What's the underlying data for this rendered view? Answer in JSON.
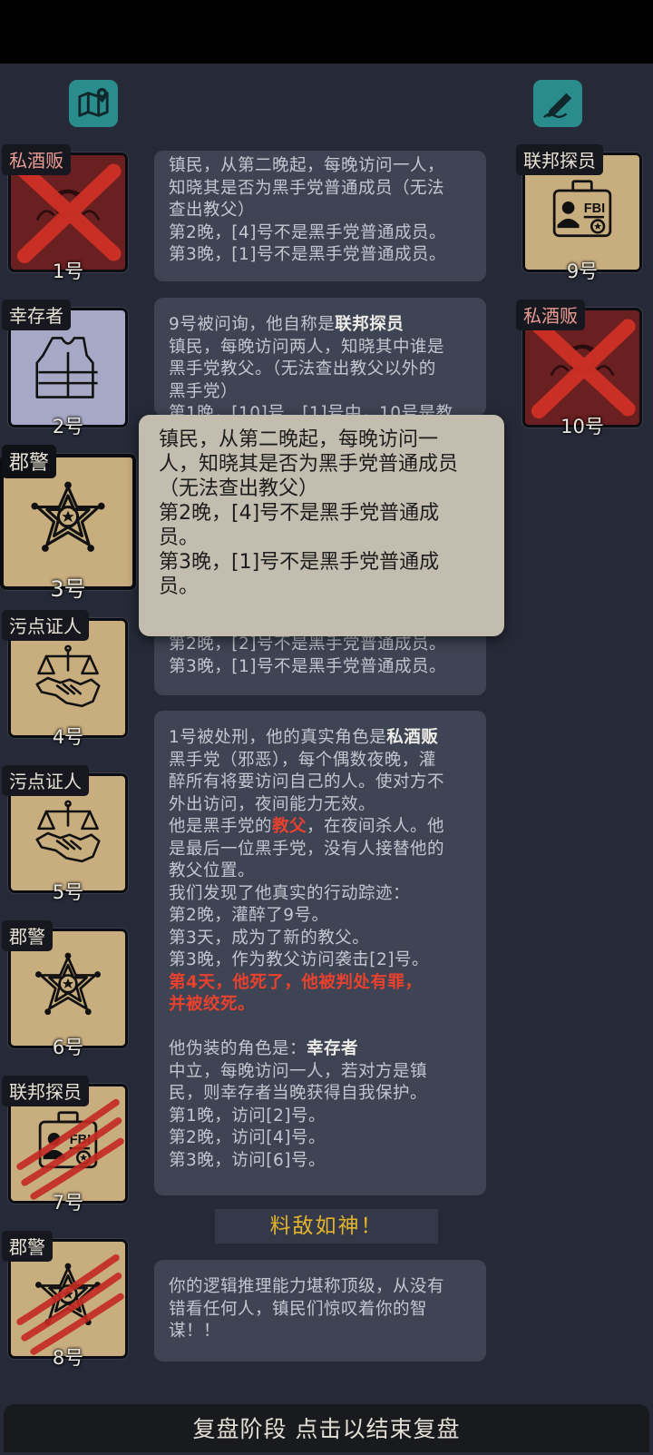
{
  "top_icons": {
    "map": "map-pin-icon",
    "notes": "pen-edit-icon"
  },
  "players": [
    {
      "tag": "私酒贩",
      "number": "1号",
      "icon": "bootlegger-icon",
      "state": "executed"
    },
    {
      "tag": "幸存者",
      "number": "2号",
      "icon": "vest-icon",
      "state": "alive"
    },
    {
      "tag": "郡警",
      "number": "3号",
      "icon": "sheriff-badge-icon",
      "state": "selected"
    },
    {
      "tag": "污点证人",
      "number": "4号",
      "icon": "scales-handshake-icon",
      "state": "alive"
    },
    {
      "tag": "污点证人",
      "number": "5号",
      "icon": "scales-handshake-icon",
      "state": "alive"
    },
    {
      "tag": "郡警",
      "number": "6号",
      "icon": "sheriff-badge-icon",
      "state": "alive"
    },
    {
      "tag": "联邦探员",
      "number": "7号",
      "icon": "fbi-badge-icon",
      "state": "killed"
    },
    {
      "tag": "郡警",
      "number": "8号",
      "icon": "sheriff-badge-icon",
      "state": "killed"
    },
    {
      "tag": "联邦探员",
      "number": "9号",
      "icon": "fbi-badge-icon",
      "state": "alive"
    },
    {
      "tag": "私酒贩",
      "number": "10号",
      "icon": "bootlegger-icon",
      "state": "executed"
    }
  ],
  "log": {
    "b1": [
      "镇民，从第二晚起，每晚访问一人，",
      "知晓其是否为黑手党普通成员（无法",
      "查出教父）",
      "第2晚，[4]号不是黑手党普通成员。",
      "第3晚，[1]号不是黑手党普通成员。"
    ],
    "b2": {
      "prefix": "9号被问询，他自称是",
      "role": "联邦探员",
      "lines": [
        "镇民，每晚访问两人，知晓其中谁是",
        "黑手党教父。（无法查出教父以外的",
        "黑手党）",
        "第1晚，[10]号、[1]号中，10号是教"
      ]
    },
    "b3": [
      "第2晚，[2]号不是黑手党普通成员。",
      "第3晚，[1]号不是黑手党普通成员。"
    ],
    "b4": {
      "l1_prefix": "1号被处刑，他的真实角色是",
      "l1_role": "私酒贩",
      "lines_a": [
        "黑手党（邪恶），每个偶数夜晚，灌",
        "醉所有将要访问自己的人。使对方不",
        "外出访问，夜间能力无效。"
      ],
      "godfather_prefix": "他是黑手党的",
      "godfather_word": "教父",
      "godfather_suffix": "，在夜间杀人。他",
      "lines_b": [
        "是最后一位黑手党，没有人接替他的",
        "教父位置。",
        "我们发现了他真实的行动踪迹：",
        "第2晚，灌醉了9号。",
        "第3天，成为了新的教父。",
        "第3晚，作为教父访问袭击[2]号。"
      ],
      "death_lines": [
        "第4天，他死了，他被判处有罪，",
        "并被绞死。"
      ],
      "fake_prefix": "他伪装的角色是：",
      "fake_role": "幸存者",
      "lines_c": [
        "中立，每晚访问一人，若对方是镇",
        "民，则幸存者当晚获得自我保护。",
        "第1晚，访问[2]号。",
        "第2晚，访问[4]号。",
        "第3晚，访问[6]号。"
      ]
    },
    "banner": "料敌如神！",
    "b5": [
      "你的逻辑推理能力堪称顶级，从没有",
      "错看任何人，镇民们惊叹着你的智",
      "谋！！"
    ]
  },
  "popup": [
    "镇民，从第二晚起，每晚访问一",
    "人，知晓其是否为黑手党普通成员",
    "（无法查出教父）",
    "第2晚，[4]号不是黑手党普通成",
    "员。",
    "第3晚，[1]号不是黑手党普通成",
    "员。"
  ],
  "bottom_bar": "复盘阶段 点击以结束复盘",
  "colors": {
    "accent_red": "#e8412e",
    "banner_gold": "#e3b52c",
    "icon_teal": "#2a8c8c"
  }
}
